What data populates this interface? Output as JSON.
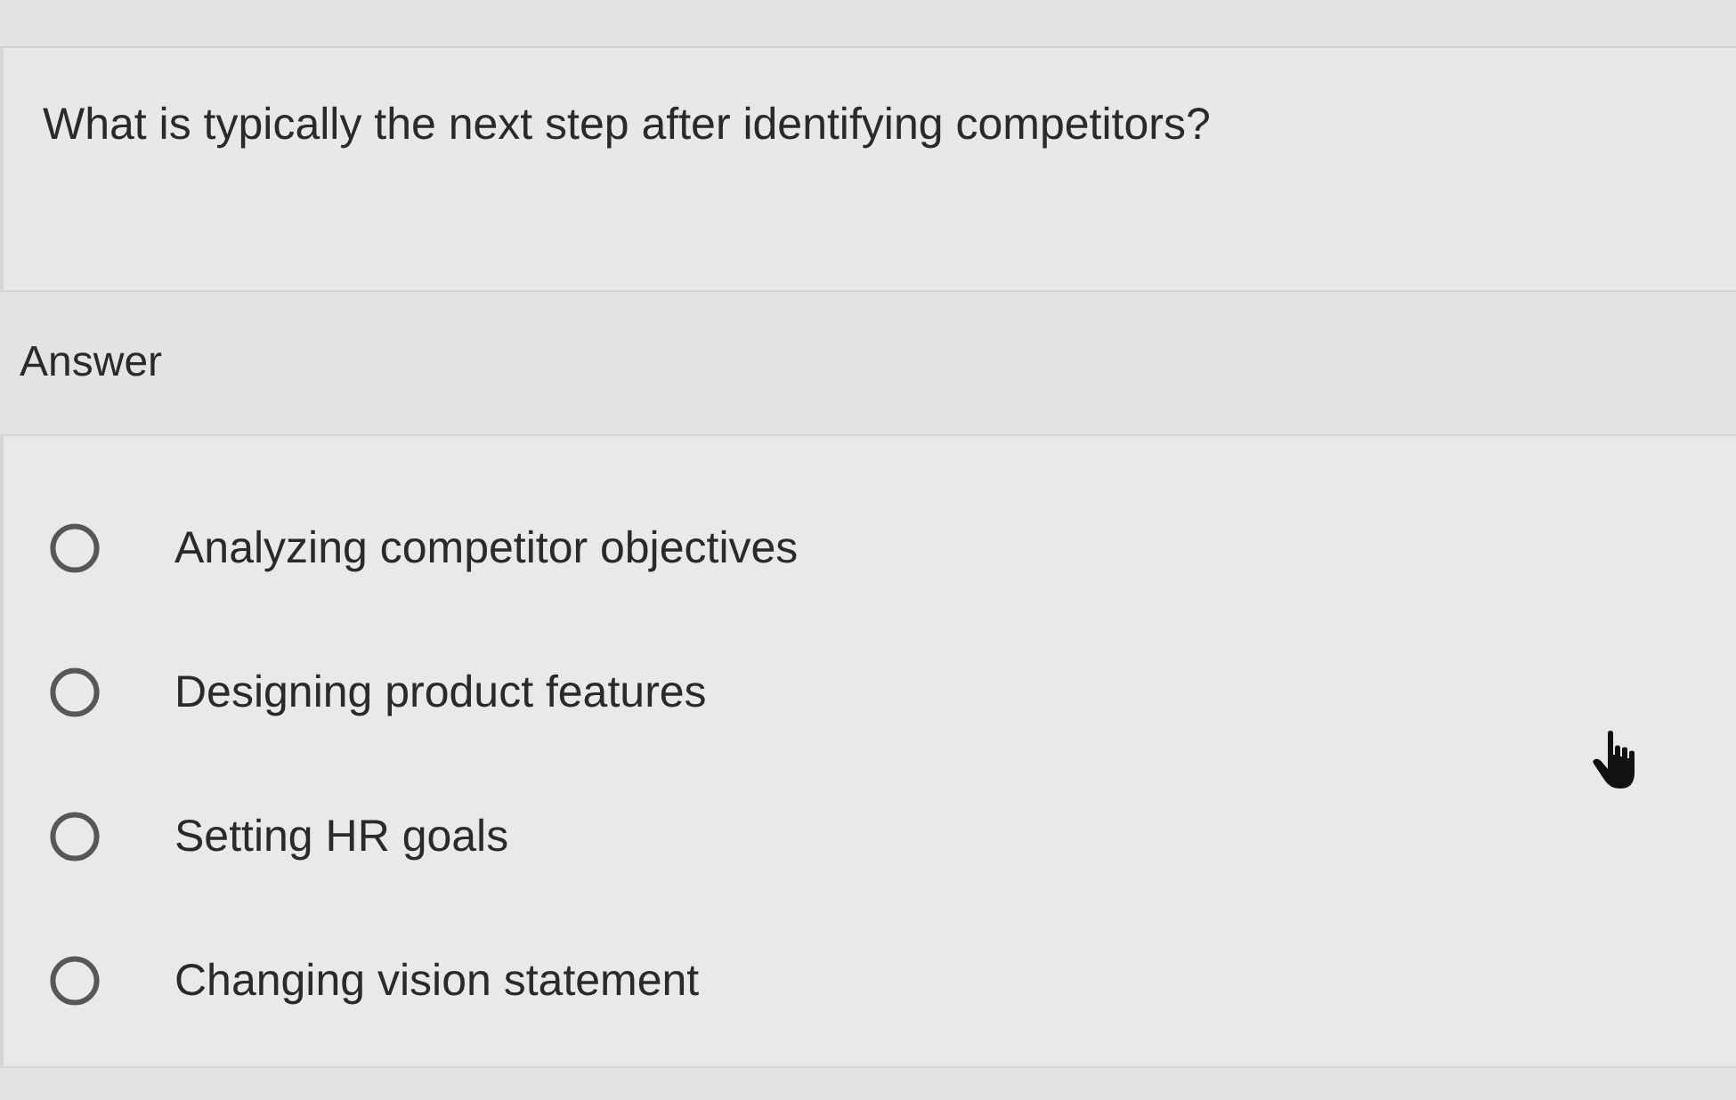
{
  "question": {
    "text": "What is typically the next step after identifying competitors?"
  },
  "answer_label": "Answer",
  "options": [
    {
      "label": "Analyzing competitor objectives",
      "selected": false
    },
    {
      "label": "Designing product features",
      "selected": false
    },
    {
      "label": "Setting HR goals",
      "selected": false
    },
    {
      "label": "Changing vision statement",
      "selected": false
    }
  ],
  "pointer": {
    "kind": "hand"
  }
}
